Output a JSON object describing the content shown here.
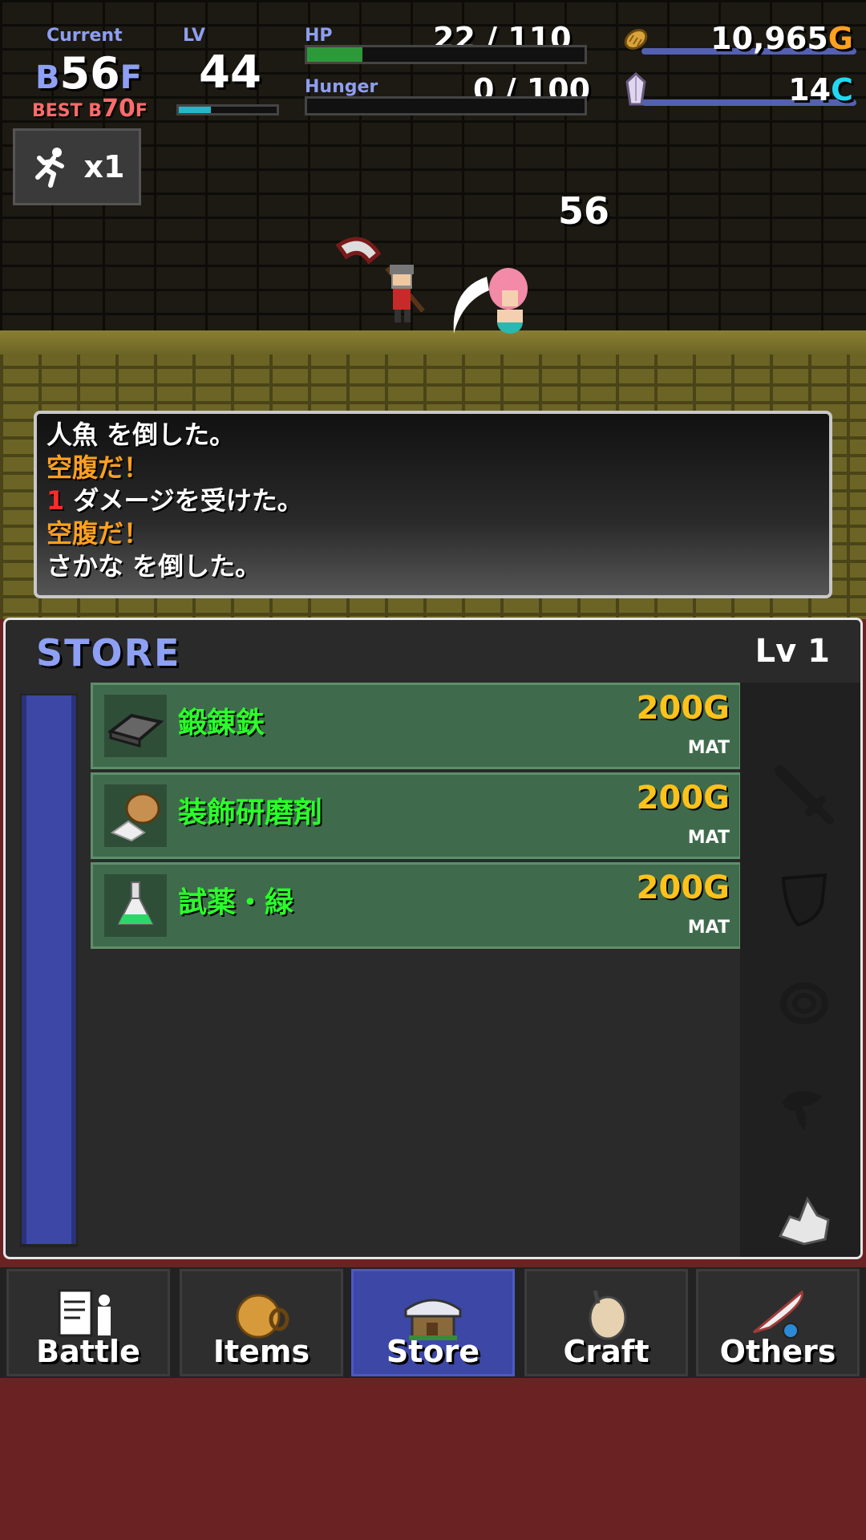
{
  "hud": {
    "current_label": "Current",
    "floor_prefix": "B",
    "floor_value": "56",
    "floor_suffix": "F",
    "best_prefix": "BEST B",
    "best_value": "70",
    "best_suffix": "F",
    "lv_label": "LV",
    "lv_value": "44",
    "lv_progress": 0.33,
    "hp_label": "HP",
    "hp_text": "22 / 110",
    "hp_progress": 0.2,
    "hunger_label": "Hunger",
    "hunger_text": "0 / 100",
    "hunger_progress": 0,
    "gold_value": "10,965",
    "gold_unit": "G",
    "crystal_value": "14",
    "crystal_unit": "C"
  },
  "speed": {
    "label": "x1"
  },
  "battle": {
    "damage_number": "56"
  },
  "log": [
    {
      "text": "人魚 を倒した。",
      "color": "#ffffff"
    },
    {
      "text": "空腹だ！",
      "color": "#ffa020"
    },
    {
      "num": "1",
      "text": " ダメージを受けた。",
      "color": "#ffffff",
      "num_color": "#ff2a2a"
    },
    {
      "text": "空腹だ！",
      "color": "#ffa020"
    },
    {
      "text": "さかな を倒した。",
      "color": "#ffffff"
    }
  ],
  "store": {
    "title": "STORE",
    "level": "Lv 1",
    "items": [
      {
        "name": "鍛錬鉄",
        "price": "200G",
        "type": "MAT",
        "icon": "iron-ingot-icon"
      },
      {
        "name": "装飾研磨剤",
        "price": "200G",
        "type": "MAT",
        "icon": "polish-bag-icon"
      },
      {
        "name": "試薬・緑",
        "price": "200G",
        "type": "MAT",
        "icon": "green-flask-icon"
      }
    ],
    "categories": [
      "sword-icon",
      "shield-icon",
      "ring-icon",
      "herb-icon",
      "ore-icon"
    ]
  },
  "tabs": [
    {
      "label": "Battle",
      "icon": "battle-icon",
      "active": false
    },
    {
      "label": "Items",
      "icon": "items-icon",
      "active": false
    },
    {
      "label": "Store",
      "icon": "store-icon",
      "active": true
    },
    {
      "label": "Craft",
      "icon": "craft-icon",
      "active": false
    },
    {
      "label": "Others",
      "icon": "others-icon",
      "active": false
    }
  ],
  "colors": {
    "accent": "#3c47a6",
    "gold": "#ffc21a",
    "cyan": "#22d8f0",
    "item_name": "#2bff2b",
    "background": "#6b2222"
  }
}
